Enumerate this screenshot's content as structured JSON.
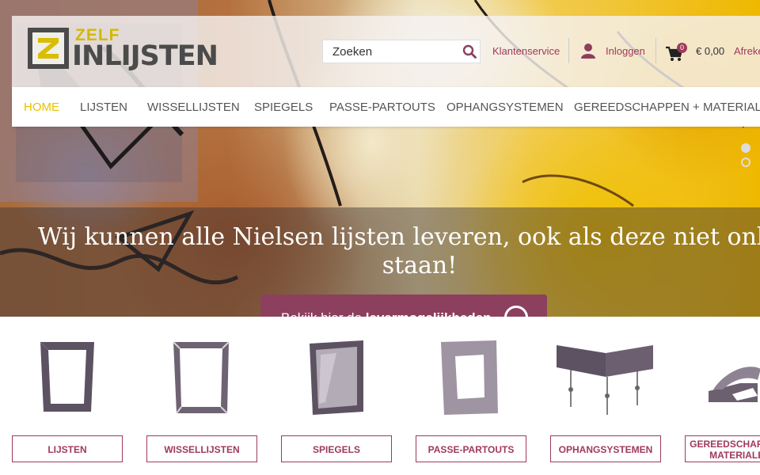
{
  "brand": {
    "logo_top": "ZELF",
    "logo_main": "INLIJSTEN",
    "accent": "#e6c200",
    "primary": "#a03a5a"
  },
  "search": {
    "placeholder": "Zoeken",
    "icon": "search-icon"
  },
  "header_links": {
    "customer_service": "Klantenservice",
    "login": "Inloggen",
    "cart_count": "0",
    "cart_total": "€ 0,00",
    "checkout": "Afreke"
  },
  "nav": {
    "items": [
      {
        "label": "HOME",
        "active": true
      },
      {
        "label": "LIJSTEN"
      },
      {
        "label": "WISSELLIJSTEN"
      },
      {
        "label": "SPIEGELS"
      },
      {
        "label": "PASSE-PARTOUTS"
      },
      {
        "label": "OPHANGSYSTEMEN"
      },
      {
        "label": "GEREEDSCHAPPEN + MATERIALEN"
      }
    ]
  },
  "hero": {
    "title": "Wij kunnen alle Nielsen lijsten leveren, ook als deze niet online staan!",
    "cta_prefix": "Bekijk hier de ",
    "cta_strong": "levermogelijkheden"
  },
  "categories": [
    {
      "label": "LIJSTEN"
    },
    {
      "label": "WISSELLIJSTEN"
    },
    {
      "label": "SPIEGELS"
    },
    {
      "label": "PASSE-PARTOUTS"
    },
    {
      "label": "OPHANGSYSTEMEN"
    },
    {
      "label": "GEREEDSCHAPPEN + MATERIALEN"
    }
  ]
}
